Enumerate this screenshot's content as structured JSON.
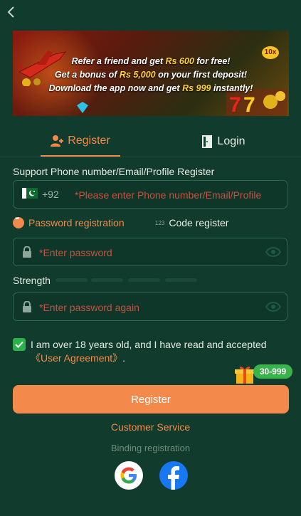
{
  "banner": {
    "line1": {
      "pre": "Refer a friend and get ",
      "hl": "Rs 600",
      "post": " for free!"
    },
    "line2": {
      "pre": "Get a bonus of ",
      "hl": "Rs 5,000",
      "post": " on your first deposit!"
    },
    "line3": {
      "pre": "Download the app now and get ",
      "hl": "Rs 999",
      "post": " instantly!"
    },
    "badge": "10x"
  },
  "tabs": {
    "register": "Register",
    "login": "Login"
  },
  "form": {
    "phone_label": "Support Phone number/Email/Profile Register",
    "country_code": "+92",
    "phone_placeholder": "*Please enter Phone number/Email/Profile",
    "password_registration": "Password registration",
    "code_badge": "123",
    "code_register": "Code register",
    "password_placeholder": "*Enter password",
    "strength_label": "Strength",
    "password_again_placeholder": "*Enter password again",
    "agree_text": "I am over 18 years old, and I have read and accepted ",
    "agree_link": "《User Agreement》",
    "agree_end": ".",
    "bonus_badge": "30-999",
    "register_button": "Register"
  },
  "footer": {
    "customer_service": "Customer Service",
    "binding_registration": "Binding registration",
    "social": [
      "google-icon",
      "facebook-icon"
    ]
  },
  "colors": {
    "background": "#113b2c",
    "accent": "#f3894a",
    "checkbox": "#2bb04a",
    "facebook": "#1877f2"
  }
}
